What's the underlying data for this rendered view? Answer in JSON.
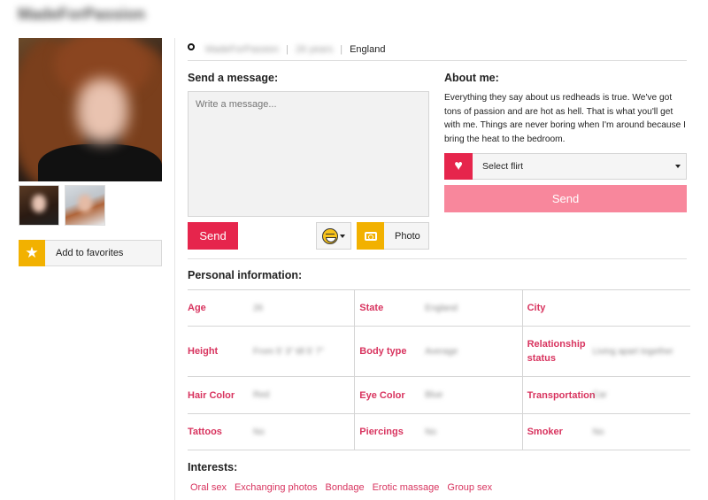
{
  "profile": {
    "username": "MadeForPassion",
    "age_text": "26 years",
    "country": "England"
  },
  "actions": {
    "favorites_label": "Add to favorites"
  },
  "message": {
    "section_title": "Send a message:",
    "placeholder": "Write a message...",
    "send_label": "Send",
    "photo_label": "Photo"
  },
  "about": {
    "section_title": "About me:",
    "text": "Everything they say about us redheads is true. We've got tons of passion and are hot as hell. That is what you'll get with me. Things are never boring when I'm around because I bring the heat to the bedroom.",
    "flirt_label": "Select flirt",
    "send_label": "Send"
  },
  "personal": {
    "section_title": "Personal information:",
    "rows": [
      [
        {
          "label": "Age",
          "value": "26"
        },
        {
          "label": "State",
          "value": "England"
        },
        {
          "label": "City",
          "value": ""
        }
      ],
      [
        {
          "label": "Height",
          "value": "From 5' 3\" till 5' 7\""
        },
        {
          "label": "Body type",
          "value": "Average"
        },
        {
          "label": "Relationship status",
          "value": "Living apart together"
        }
      ],
      [
        {
          "label": "Hair Color",
          "value": "Red"
        },
        {
          "label": "Eye Color",
          "value": "Blue"
        },
        {
          "label": "Transportation",
          "value": "Car"
        }
      ],
      [
        {
          "label": "Tattoos",
          "value": "No"
        },
        {
          "label": "Piercings",
          "value": "No"
        },
        {
          "label": "Smoker",
          "value": "No"
        }
      ]
    ]
  },
  "interests": {
    "section_title": "Interests:",
    "items": [
      "Oral sex",
      "Exchanging photos",
      "Bondage",
      "Erotic massage",
      "Group sex"
    ]
  },
  "colors": {
    "accent": "#e6254c",
    "accent_light": "#f8879c",
    "label_pink": "#d8345f",
    "icon_yellow": "#f2b100"
  },
  "icons": {
    "favorites": "star-icon",
    "location": "location-pin-icon",
    "emoji": "smiley-icon",
    "photo": "camera-icon",
    "flirt": "heart-icon"
  }
}
